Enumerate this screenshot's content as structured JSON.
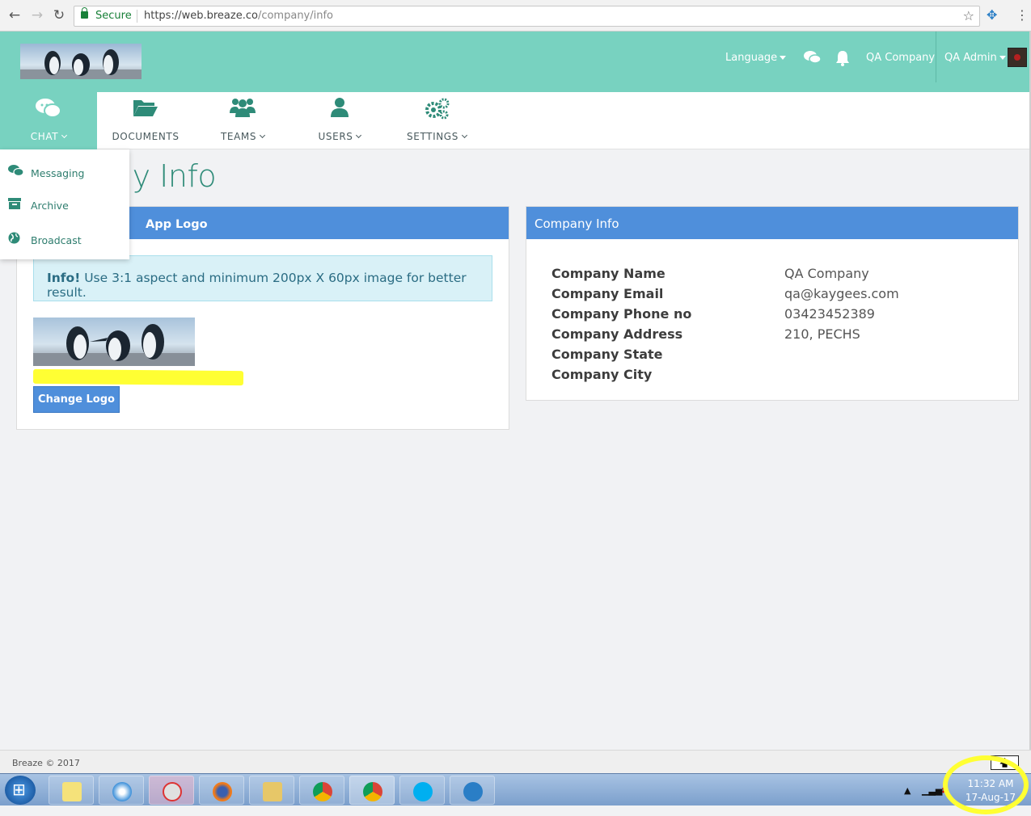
{
  "browser": {
    "secure_label": "Secure",
    "url_base": "https://web.breaze.co",
    "url_path": "/company/info"
  },
  "header": {
    "language_label": "Language",
    "company_label": "QA Company",
    "user_label": "QA Admin",
    "accent_color": "#78d2c0"
  },
  "nav": {
    "items": [
      {
        "label": "CHAT",
        "icon": "chat-icon"
      },
      {
        "label": "DOCUMENTS",
        "icon": "folder-icon"
      },
      {
        "label": "TEAMS",
        "icon": "team-icon"
      },
      {
        "label": "USERS",
        "icon": "user-icon"
      },
      {
        "label": "SETTINGS",
        "icon": "gears-icon"
      }
    ]
  },
  "chat_dropdown": {
    "items": [
      {
        "label": "Messaging",
        "icon": "messaging-icon"
      },
      {
        "label": "Archive",
        "icon": "archive-icon"
      },
      {
        "label": "Broadcast",
        "icon": "globe-icon"
      }
    ]
  },
  "page": {
    "title_visible": "ny Info"
  },
  "logo_panel": {
    "title": "App Logo",
    "info_strong": "Info!",
    "info_text": " Use 3:1 aspect and minimum 200px X 60px image for better result.",
    "button_label": "Change Logo"
  },
  "info_panel": {
    "title": "Company Info",
    "rows": [
      {
        "key": "Company Name",
        "value": "QA Company"
      },
      {
        "key": "Company Email",
        "value": "qa@kaygees.com"
      },
      {
        "key": "Company Phone no",
        "value": "03423452389"
      },
      {
        "key": "Company Address",
        "value": "210, PECHS"
      },
      {
        "key": "Company State",
        "value": ""
      },
      {
        "key": "Company City",
        "value": ""
      }
    ]
  },
  "footer": {
    "text": "Breaze © 2017"
  },
  "taskbar": {
    "time": "11:32 AM",
    "date": "17-Aug-17"
  }
}
